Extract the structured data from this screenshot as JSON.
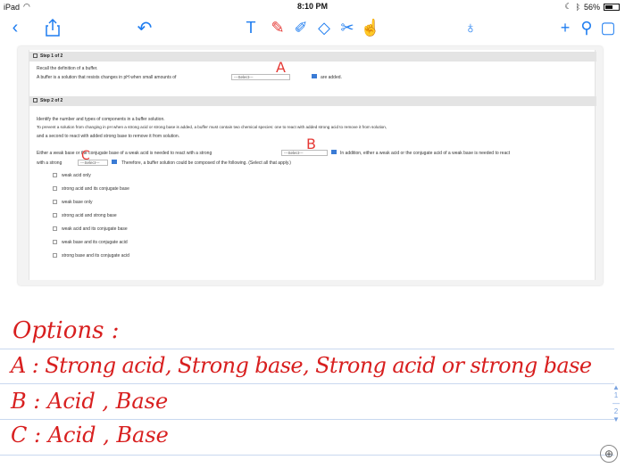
{
  "status": {
    "device": "iPad",
    "time": "8:10 PM",
    "battery": "56%",
    "battery_level": 0.56
  },
  "toolbar": {
    "icons": [
      "back-chevron-icon",
      "share-icon",
      "undo-icon",
      "text-tool-icon",
      "marker-pen-icon",
      "pencil-icon",
      "eraser-icon",
      "scissors-icon",
      "hand-icon",
      "pen-nib-icon",
      "plus-icon",
      "wrench-icon",
      "square-icon"
    ]
  },
  "pasted": {
    "step1": {
      "header": "Step 1 of 2",
      "line1": "Recall the definition of a buffer.",
      "line2": "A buffer is a solution that resists changes in pH when small amounts of",
      "select": "---Select---",
      "after": "are added."
    },
    "step2": {
      "header": "Step 2 of 2",
      "line1": "Identify the number and types of components in a buffer solution.",
      "line2": "To prevent a solution from changing in pH when a strong acid or strong base is added, a buffer must contain two chemical species: one to react with added strong acid to remove it from solution,",
      "line3": "and a second to react with added strong base to remove it from solution.",
      "line4a": "Either a weak base or the conjugate base of a weak acid is needed to react with a strong",
      "select_b": "---Select---",
      "line4b": "In addition, either a weak acid or the conjugate acid of a weak base is needed to react",
      "line5a": "with a strong",
      "select_c": "---Select---",
      "line5b": "Therefore, a buffer solution could be composed of the following. (Select all that apply.)",
      "options": [
        "weak acid only",
        "strong acid and its conjugate base",
        "weak base only",
        "strong acid and strong base",
        "weak acid and its conjugate base",
        "weak base and its conjugate acid",
        "strong base and its conjugate acid"
      ]
    },
    "annotations": {
      "a": "A",
      "b": "B",
      "c": "C"
    }
  },
  "notes": {
    "heading": "Options :",
    "line_a": "A : Strong acid, Strong base, Strong acid or strong base",
    "line_b": "B : Acid , Base",
    "line_c": "C : Acid , Base"
  },
  "pager": {
    "current": "1",
    "total": "2"
  }
}
